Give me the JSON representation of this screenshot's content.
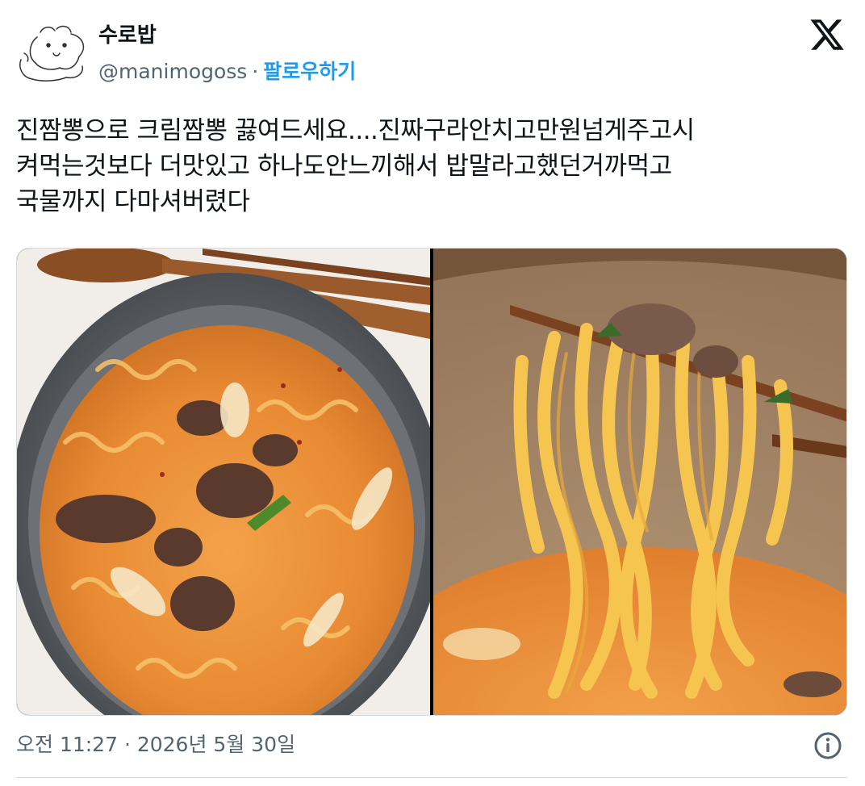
{
  "author": {
    "display_name": "수로밥",
    "handle": "@manimogoss",
    "separator": "·",
    "follow_label": "팔로우하기",
    "avatar_icon": "sketch-animal-avatar-icon"
  },
  "brand": {
    "logo_icon": "x-logo-icon"
  },
  "tweet": {
    "text_lines": [
      "진짬뽕으로 크림짬뽕 끓여드세요....진짜구라안치고만원넘게주고시",
      "켜먹는것보다 더맛있고 하나도안느끼해서 밥말라고했던거까먹고",
      "국물까지 다마셔버렸다"
    ]
  },
  "media": {
    "photos": [
      "cream-jjamppong-pot-photo",
      "noodles-on-chopsticks-photo"
    ]
  },
  "footer": {
    "timestamp": "오전 11:27 · 2026년 5월 30일",
    "info_icon": "info-icon"
  },
  "colors": {
    "text": "#0f1419",
    "secondary": "#536471",
    "accent": "#1d9bf0",
    "border": "#cfd9de"
  }
}
